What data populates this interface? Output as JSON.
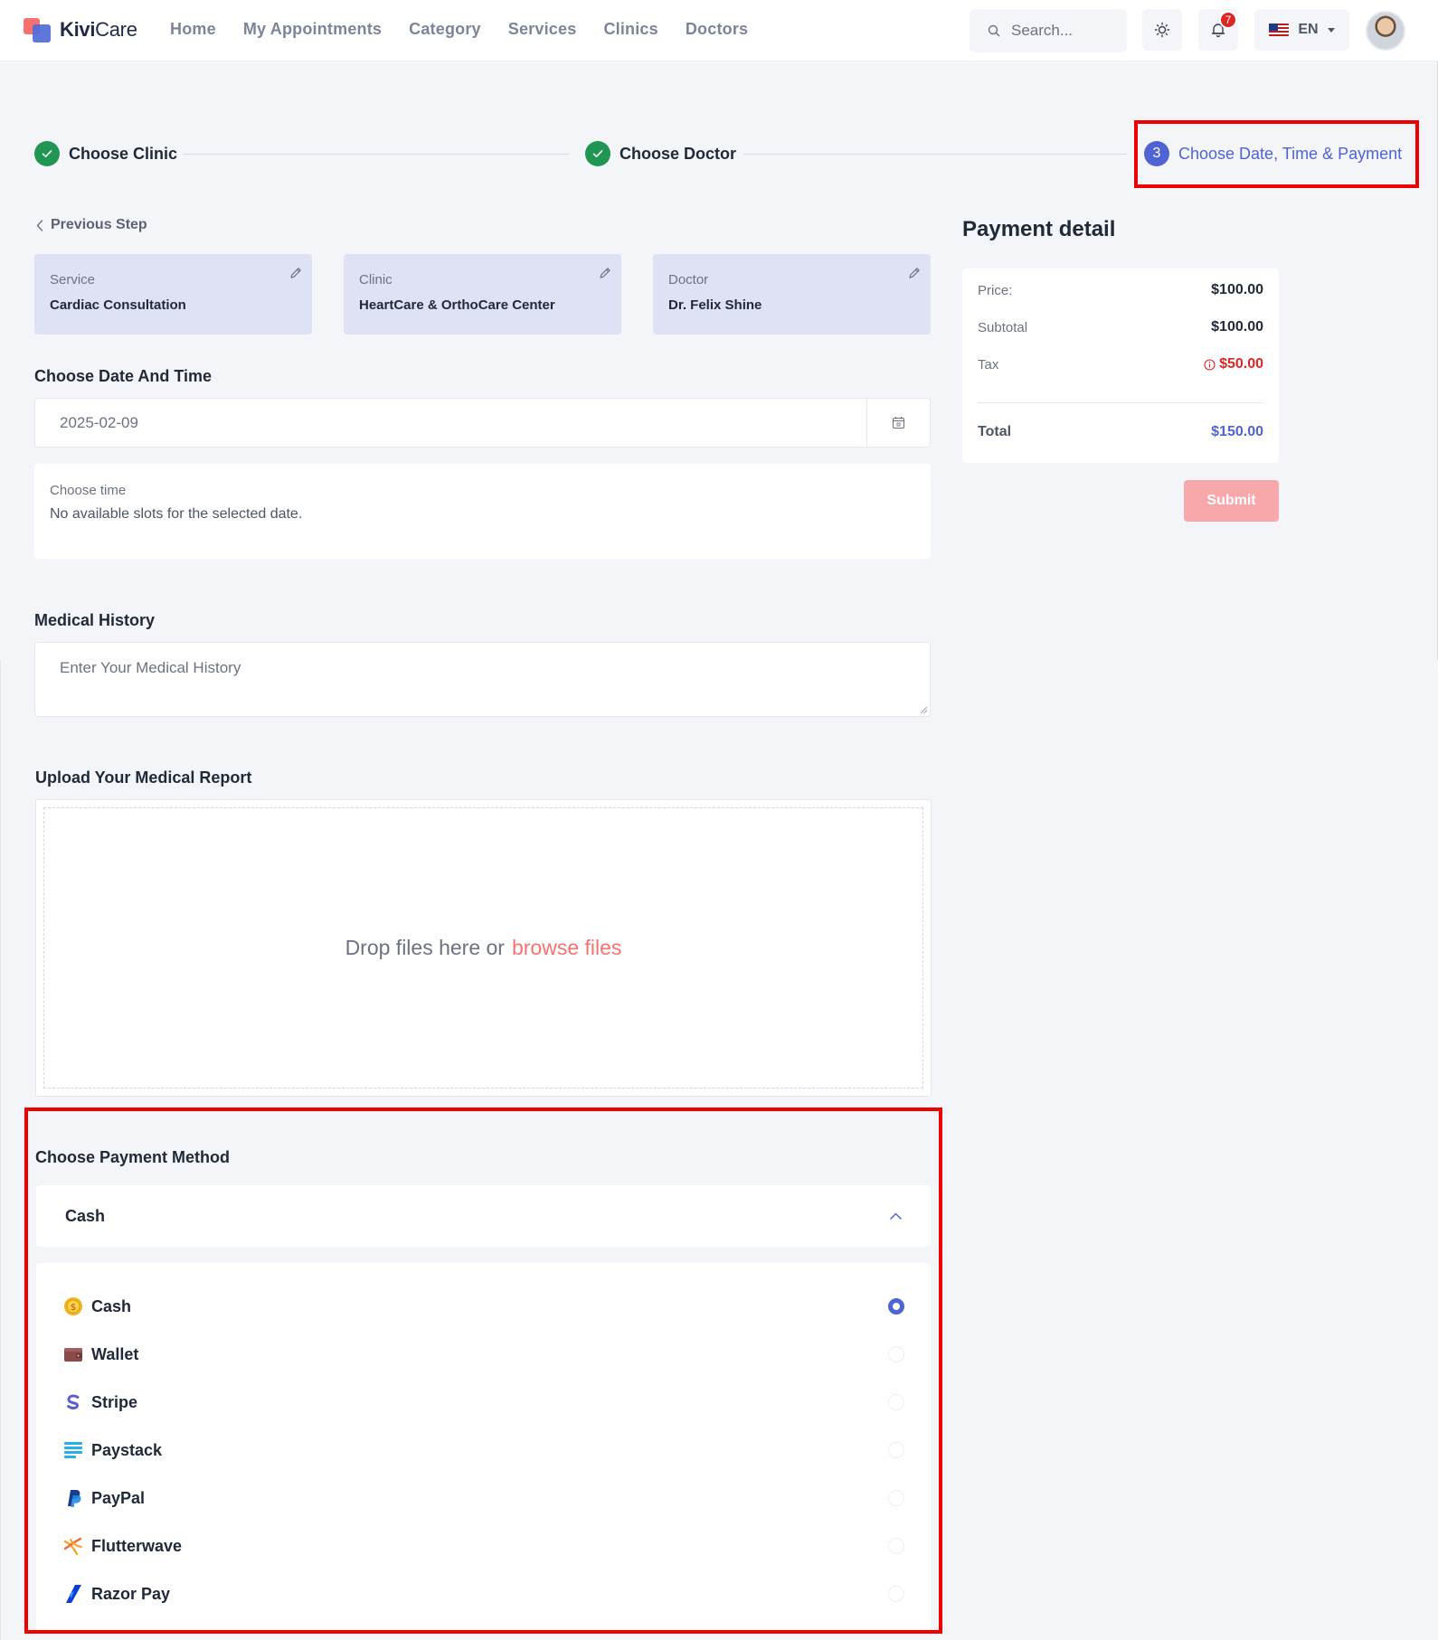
{
  "header": {
    "brand_bold": "Kivi",
    "brand_light": "Care",
    "nav": [
      "Home",
      "My Appointments",
      "Category",
      "Services",
      "Clinics",
      "Doctors"
    ],
    "search_placeholder": "Search...",
    "notification_count": "7",
    "language": "EN"
  },
  "stepper": {
    "step1": "Choose Clinic",
    "step2": "Choose Doctor",
    "step3_number": "3",
    "step3": "Choose Date, Time & Payment"
  },
  "form": {
    "previous_step": "Previous Step",
    "summary": [
      {
        "key": "Service",
        "value": "Cardiac Consultation"
      },
      {
        "key": "Clinic",
        "value": "HeartCare & OrthoCare Center"
      },
      {
        "key": "Doctor",
        "value": "Dr. Felix Shine"
      }
    ],
    "date_title": "Choose Date And Time",
    "date_value": "2025-02-09",
    "time_label": "Choose time",
    "time_message": "No available slots for the selected date.",
    "history_title": "Medical History",
    "history_placeholder": "Enter Your Medical History",
    "upload_title": "Upload Your Medical Report",
    "upload_text": "Drop files here or",
    "upload_link": "browse files"
  },
  "payment_method": {
    "title": "Choose Payment Method",
    "selected": "Cash",
    "options": [
      "Cash",
      "Wallet",
      "Stripe",
      "Paystack",
      "PayPal",
      "Flutterwave",
      "Razor Pay"
    ]
  },
  "payment_detail": {
    "title": "Payment detail",
    "price_label": "Price:",
    "price": "$100.00",
    "subtotal_label": "Subtotal",
    "subtotal": "$100.00",
    "tax_label": "Tax",
    "tax": "$50.00",
    "total_label": "Total",
    "total": "$150.00",
    "submit": "Submit"
  },
  "colors": {
    "accent": "#4f63d2",
    "success": "#219653",
    "danger": "#dc2626",
    "highlight": "#ee0000",
    "submit_bg": "#f8a8aa",
    "link": "#f87171"
  }
}
